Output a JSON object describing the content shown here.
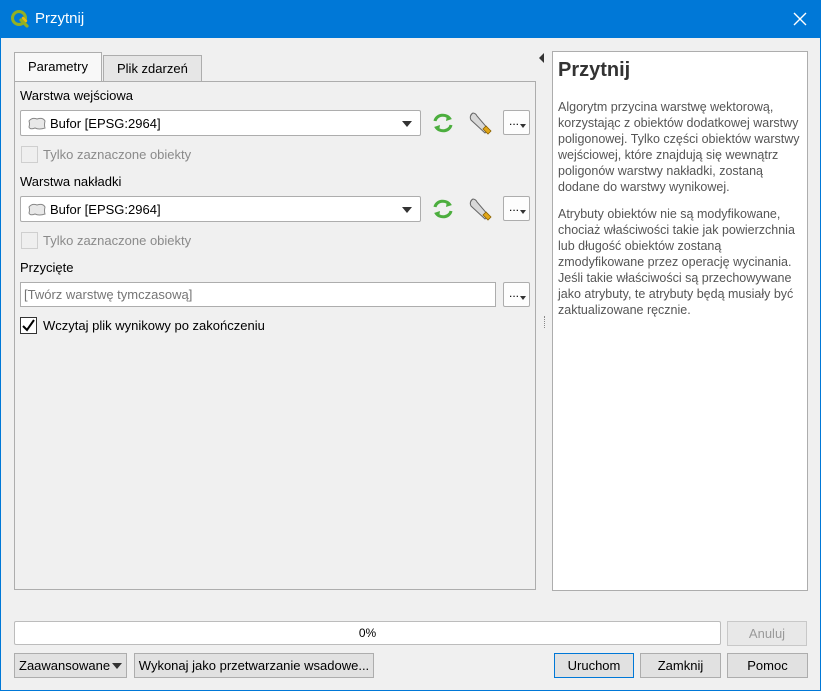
{
  "window": {
    "title": "Przytnij",
    "close_icon": "close-icon",
    "app_icon": "qgis-icon"
  },
  "tabs": [
    {
      "label": "Parametry",
      "active": true
    },
    {
      "label": "Plik zdarzeń",
      "active": false
    }
  ],
  "params": {
    "input_layer": {
      "label": "Warstwa wejściowa",
      "value": "Bufor [EPSG:2964]",
      "selected_only_label": "Tylko zaznaczone obiekty",
      "selected_only_checked": false
    },
    "overlay_layer": {
      "label": "Warstwa nakładki",
      "value": "Bufor [EPSG:2964]",
      "selected_only_label": "Tylko zaznaczone obiekty",
      "selected_only_checked": false
    },
    "output": {
      "label": "Przycięte",
      "placeholder": "[Twórz warstwę tymczasową]",
      "value": ""
    },
    "load_result": {
      "label": "Wczytaj plik wynikowy po zakończeniu",
      "checked": true
    },
    "dots_label": "..."
  },
  "help": {
    "title": "Przytnij",
    "paragraphs": [
      "Algorytm przycina warstwę wektorową, korzystając z obiektów dodatkowej warstwy poligonowej. Tylko części obiektów warstwy wejściowej, które znajdują się wewnątrz poligonów warstwy nakładki, zostaną dodane do warstwy wynikowej.",
      "Atrybuty obiektów nie są modyfikowane, chociaż właściwości takie jak powierzchnia lub długość obiektów zostaną zmodyfikowane przez operację wycinania. Jeśli takie właściwości są przechowywane jako atrybuty, te atrybuty będą musiały być zaktualizowane ręcznie."
    ]
  },
  "progress": {
    "value": 0,
    "text": "0%"
  },
  "buttons": {
    "cancel": "Anuluj",
    "advanced": "Zaawansowane",
    "batch": "Wykonaj jako przetwarzanie wsadowe...",
    "run": "Uruchom",
    "close": "Zamknij",
    "help": "Pomoc"
  },
  "colors": {
    "titlebar": "#0078d7",
    "accent": "#0078d7"
  }
}
